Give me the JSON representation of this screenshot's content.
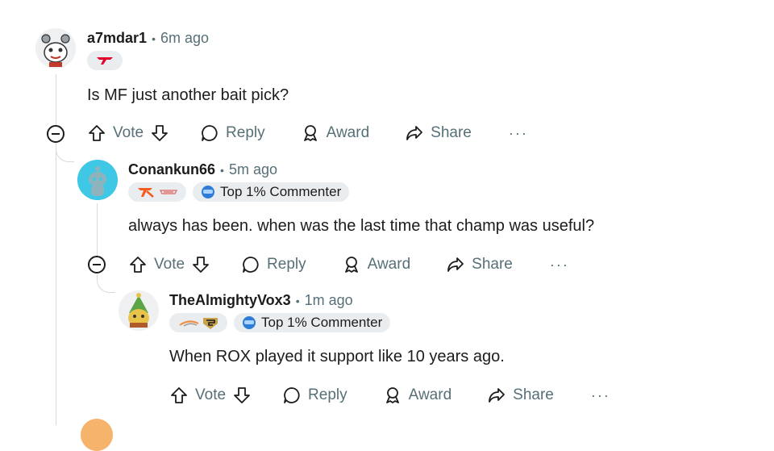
{
  "comments": [
    {
      "username": "a7mdar1",
      "time": "6m ago",
      "body": "Is MF just another bait pick?",
      "flair_text": ""
    },
    {
      "username": "Conankun66",
      "time": "5m ago",
      "body": "always has been. when was the last time that champ was useful?",
      "flair_text": "Top 1% Commenter"
    },
    {
      "username": "TheAlmightyVox3",
      "time": "1m ago",
      "body": "When ROX played it support like 10 years ago.",
      "flair_text": "Top 1% Commenter"
    }
  ],
  "actions": {
    "vote": "Vote",
    "reply": "Reply",
    "award": "Award",
    "share": "Share",
    "more": "···"
  },
  "icons": [
    "collapse-icon",
    "upvote-icon",
    "downvote-icon",
    "reply-icon",
    "award-icon",
    "share-icon",
    "more-icon"
  ],
  "colors": {
    "text": "#1c1c1c",
    "muted": "#576f76",
    "flair_bg": "#eaedef",
    "rail": "#d7dadc",
    "avatar2_bg": "#3fc8e6"
  }
}
